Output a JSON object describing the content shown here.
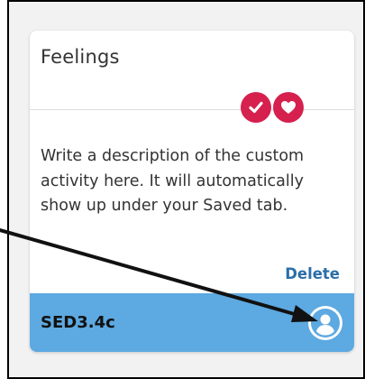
{
  "card": {
    "title": "Feelings",
    "description": "Write a description of the custom activity here. It will automatically show up under your Saved tab.",
    "delete_label": "Delete",
    "footer_code": "SED3.4c"
  },
  "icons": {
    "check": "check-icon",
    "heart": "heart-icon",
    "user": "user-icon"
  },
  "colors": {
    "badge": "#d6204e",
    "footer": "#5da9e1",
    "link": "#2a6ea8",
    "frame_background": "#f2f2f2"
  }
}
